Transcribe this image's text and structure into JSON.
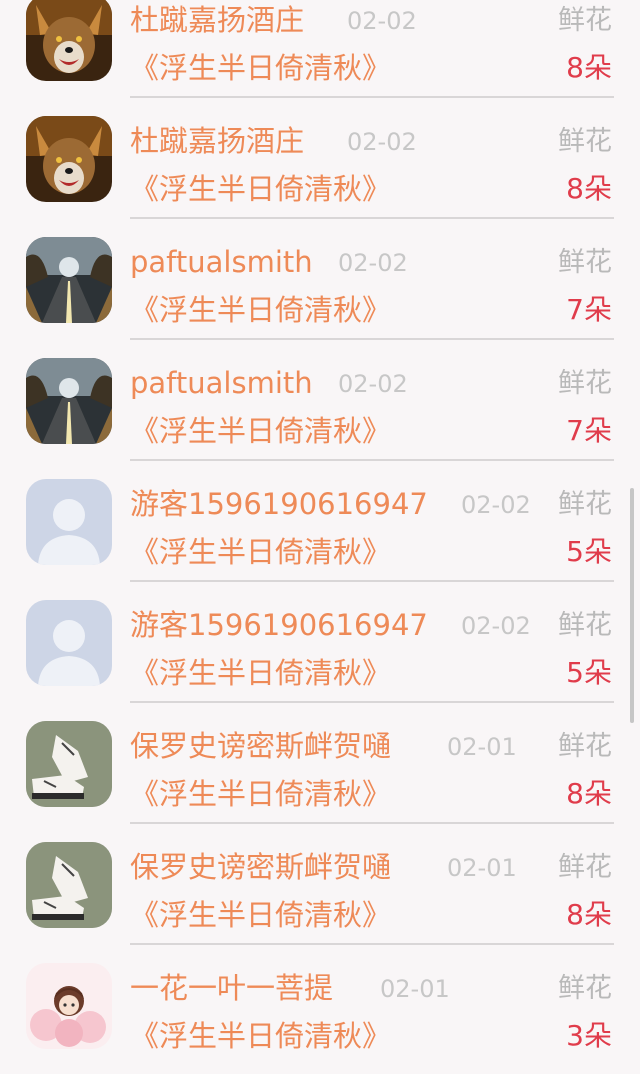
{
  "rows": [
    {
      "name": "杜蹴嘉扬酒庄",
      "date": "02-02",
      "gift": "鲜花",
      "title": "《浮生半日倚清秋》",
      "count": "8朵",
      "avatar": "wolf-avatar"
    },
    {
      "name": "杜蹴嘉扬酒庄",
      "date": "02-02",
      "gift": "鲜花",
      "title": "《浮生半日倚清秋》",
      "count": "8朵",
      "avatar": "wolf-avatar"
    },
    {
      "name": "paftualsmith",
      "date": "02-02",
      "gift": "鲜花",
      "title": "《浮生半日倚清秋》",
      "count": "7朵",
      "avatar": "road-avatar"
    },
    {
      "name": "paftualsmith",
      "date": "02-02",
      "gift": "鲜花",
      "title": "《浮生半日倚清秋》",
      "count": "7朵",
      "avatar": "road-avatar"
    },
    {
      "name": "游客1596190616947",
      "date": "02-02",
      "gift": "鲜花",
      "title": "《浮生半日倚清秋》",
      "count": "5朵",
      "avatar": "default-user-avatar"
    },
    {
      "name": "游客1596190616947",
      "date": "02-02",
      "gift": "鲜花",
      "title": "《浮生半日倚清秋》",
      "count": "5朵",
      "avatar": "default-user-avatar"
    },
    {
      "name": "保罗史谤密斯衅贺嗵",
      "date": "02-01",
      "gift": "鲜花",
      "title": "《浮生半日倚清秋》",
      "count": "8朵",
      "avatar": "sneakers-avatar"
    },
    {
      "name": "保罗史谤密斯衅贺嗵",
      "date": "02-01",
      "gift": "鲜花",
      "title": "《浮生半日倚清秋》",
      "count": "8朵",
      "avatar": "sneakers-avatar"
    },
    {
      "name": "一花一叶一菩提",
      "date": "02-01",
      "gift": "鲜花",
      "title": "《浮生半日倚清秋》",
      "count": "3朵",
      "avatar": "anime-girl-avatar"
    }
  ],
  "colors": {
    "name": "#ee8a57",
    "date": "#c7c7c7",
    "gift": "#b9b9b9",
    "count": "#e03c4b",
    "background": "#f9f6f7"
  }
}
